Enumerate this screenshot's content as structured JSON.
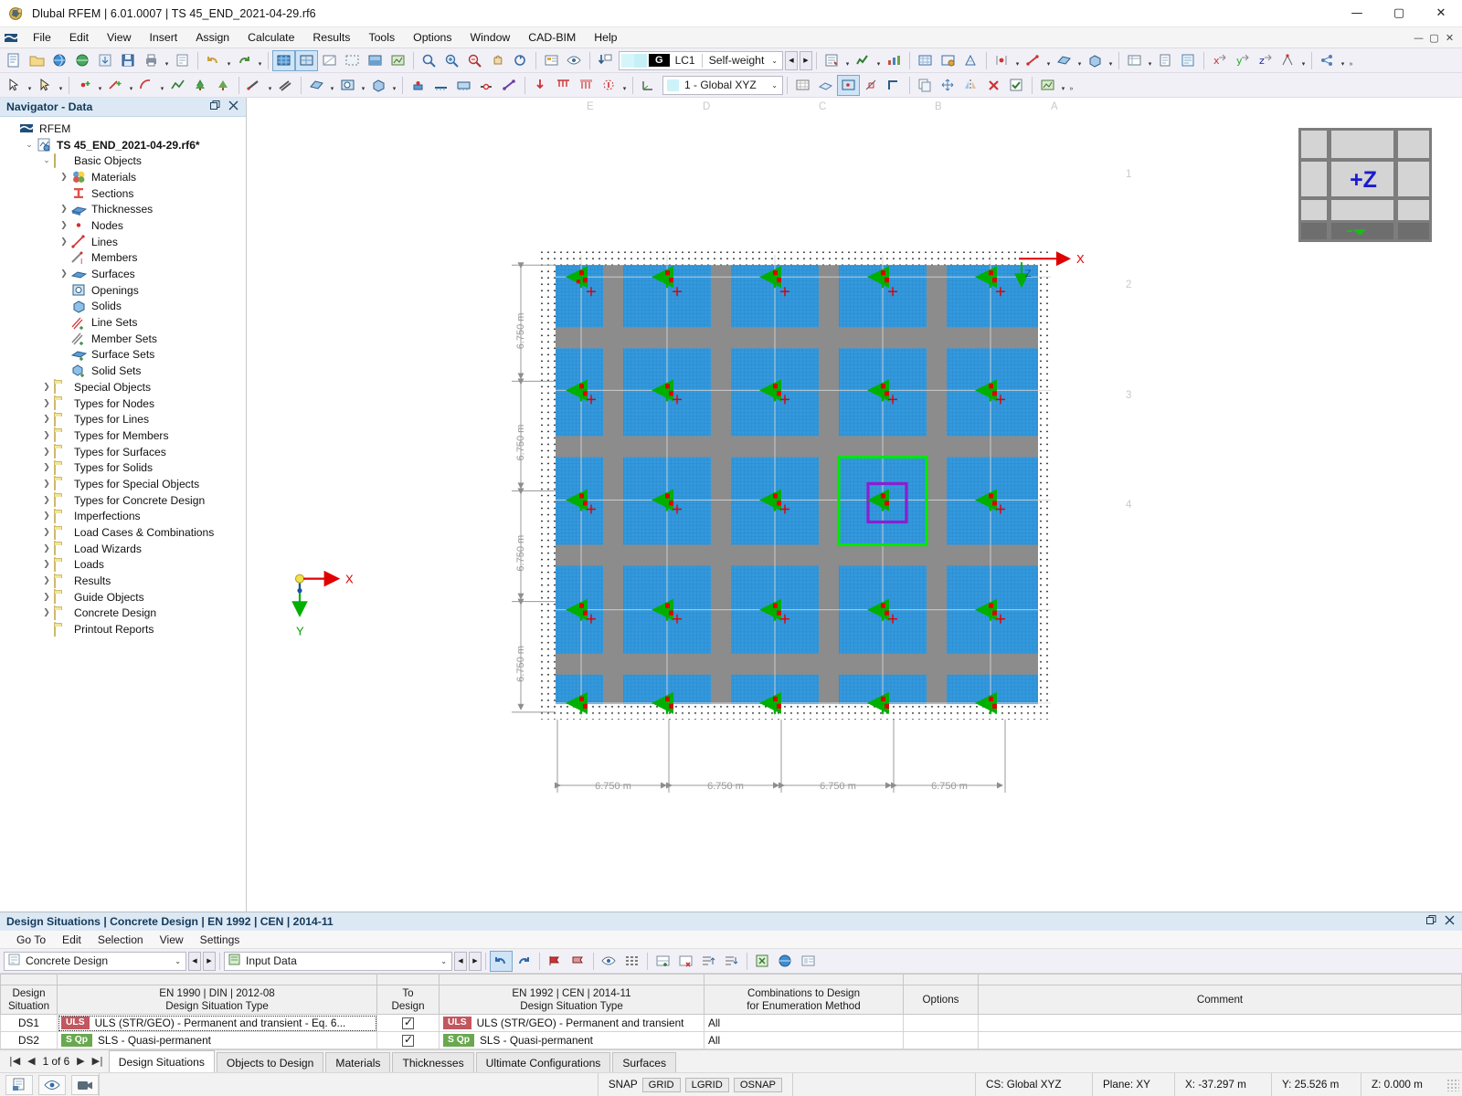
{
  "window": {
    "title": "Dlubal RFEM | 6.01.0007 | TS 45_END_2021-04-29.rf6",
    "app_icon": "rfem-logo-icon",
    "minimize": "—",
    "maximize": "▢",
    "close": "✕"
  },
  "menubar": {
    "items": [
      "File",
      "Edit",
      "View",
      "Insert",
      "Assign",
      "Calculate",
      "Results",
      "Tools",
      "Options",
      "Window",
      "CAD-BIM",
      "Help"
    ],
    "doc_buttons": [
      "—",
      "▢",
      "✕"
    ]
  },
  "toolbar": {
    "load_case": {
      "badge": "G",
      "id": "LC1",
      "name": "Self-weight",
      "caret": "⌄"
    },
    "coordinate_system": {
      "label": "1 - Global XYZ",
      "caret": "⌄"
    }
  },
  "navigator": {
    "title": "Navigator - Data",
    "restore_icon": "restore-icon",
    "close_icon": "close-icon",
    "tree": [
      {
        "label": "RFEM",
        "indent": 0,
        "twisty": "",
        "icon": "rfem-icon",
        "bold": false
      },
      {
        "label": "TS 45_END_2021-04-29.rf6*",
        "indent": 1,
        "twisty": "v",
        "icon": "model-icon",
        "bold": true
      },
      {
        "label": "Basic Objects",
        "indent": 2,
        "twisty": "v",
        "icon": "folder-open-icon",
        "bold": false
      },
      {
        "label": "Materials",
        "indent": 3,
        "twisty": ">",
        "icon": "materials-icon",
        "bold": false
      },
      {
        "label": "Sections",
        "indent": 3,
        "twisty": "",
        "icon": "sections-icon",
        "bold": false
      },
      {
        "label": "Thicknesses",
        "indent": 3,
        "twisty": ">",
        "icon": "thicknesses-icon",
        "bold": false
      },
      {
        "label": "Nodes",
        "indent": 3,
        "twisty": ">",
        "icon": "nodes-icon",
        "bold": false
      },
      {
        "label": "Lines",
        "indent": 3,
        "twisty": ">",
        "icon": "lines-icon",
        "bold": false
      },
      {
        "label": "Members",
        "indent": 3,
        "twisty": "",
        "icon": "members-icon",
        "bold": false
      },
      {
        "label": "Surfaces",
        "indent": 3,
        "twisty": ">",
        "icon": "surfaces-icon",
        "bold": false
      },
      {
        "label": "Openings",
        "indent": 3,
        "twisty": "",
        "icon": "openings-icon",
        "bold": false
      },
      {
        "label": "Solids",
        "indent": 3,
        "twisty": "",
        "icon": "solids-icon",
        "bold": false
      },
      {
        "label": "Line Sets",
        "indent": 3,
        "twisty": "",
        "icon": "line-sets-icon",
        "bold": false
      },
      {
        "label": "Member Sets",
        "indent": 3,
        "twisty": "",
        "icon": "member-sets-icon",
        "bold": false
      },
      {
        "label": "Surface Sets",
        "indent": 3,
        "twisty": "",
        "icon": "surface-sets-icon",
        "bold": false
      },
      {
        "label": "Solid Sets",
        "indent": 3,
        "twisty": "",
        "icon": "solid-sets-icon",
        "bold": false
      },
      {
        "label": "Special Objects",
        "indent": 2,
        "twisty": ">",
        "icon": "folder-icon",
        "bold": false
      },
      {
        "label": "Types for Nodes",
        "indent": 2,
        "twisty": ">",
        "icon": "folder-icon",
        "bold": false
      },
      {
        "label": "Types for Lines",
        "indent": 2,
        "twisty": ">",
        "icon": "folder-icon",
        "bold": false
      },
      {
        "label": "Types for Members",
        "indent": 2,
        "twisty": ">",
        "icon": "folder-icon",
        "bold": false
      },
      {
        "label": "Types for Surfaces",
        "indent": 2,
        "twisty": ">",
        "icon": "folder-icon",
        "bold": false
      },
      {
        "label": "Types for Solids",
        "indent": 2,
        "twisty": ">",
        "icon": "folder-icon",
        "bold": false
      },
      {
        "label": "Types for Special Objects",
        "indent": 2,
        "twisty": ">",
        "icon": "folder-icon",
        "bold": false
      },
      {
        "label": "Types for Concrete Design",
        "indent": 2,
        "twisty": ">",
        "icon": "folder-icon",
        "bold": false
      },
      {
        "label": "Imperfections",
        "indent": 2,
        "twisty": ">",
        "icon": "folder-icon",
        "bold": false
      },
      {
        "label": "Load Cases & Combinations",
        "indent": 2,
        "twisty": ">",
        "icon": "folder-icon",
        "bold": false
      },
      {
        "label": "Load Wizards",
        "indent": 2,
        "twisty": ">",
        "icon": "folder-icon",
        "bold": false
      },
      {
        "label": "Loads",
        "indent": 2,
        "twisty": ">",
        "icon": "folder-icon",
        "bold": false
      },
      {
        "label": "Results",
        "indent": 2,
        "twisty": ">",
        "icon": "folder-icon",
        "bold": false
      },
      {
        "label": "Guide Objects",
        "indent": 2,
        "twisty": ">",
        "icon": "folder-icon",
        "bold": false
      },
      {
        "label": "Concrete Design",
        "indent": 2,
        "twisty": ">",
        "icon": "folder-icon",
        "bold": false
      },
      {
        "label": "Printout Reports",
        "indent": 2,
        "twisty": "",
        "icon": "folder-icon",
        "bold": false
      }
    ]
  },
  "viewport": {
    "navcube_label": "+Z",
    "grid_letters": [
      "E",
      "D",
      "C",
      "B",
      "A"
    ],
    "grid_numbers": [
      "1",
      "2",
      "3",
      "4"
    ],
    "axis_x_label": "X",
    "axis_y_label": "Y",
    "axis_z_label": "Z",
    "dimension_label": "6.750 m",
    "vertical_dimensions": [
      "6.750 m",
      "6.750 m",
      "6.750 m",
      "6.750 m"
    ],
    "horizontal_dimensions": [
      "6.750 m",
      "6.750 m",
      "6.750 m",
      "6.750 m"
    ],
    "colors": {
      "slab": "#3399dd",
      "mesh": "#1b5fa8",
      "strip": "#8c8c8c",
      "selection_outer": "#00e800",
      "selection_inner": "#8a1fd0",
      "support_green": "#00c000",
      "support_red": "#e00000",
      "axis_red": "#e00000",
      "dimension_gray": "#9a9a9a"
    }
  },
  "bottom_panel": {
    "title": "Design Situations | Concrete Design | EN 1992 | CEN | 2014-11",
    "restore_icon": "restore-icon",
    "close_icon": "close-icon",
    "menu": [
      "Go To",
      "Edit",
      "Selection",
      "View",
      "Settings"
    ],
    "module_combo": "Concrete Design",
    "view_combo": "Input Data",
    "table": {
      "columns": [
        "Design\nSituation",
        "EN 1990 | DIN | 2012-08\nDesign Situation Type",
        "To\nDesign",
        "EN 1992 | CEN | 2014-11\nDesign Situation Type",
        "Combinations to Design\nfor Enumeration Method",
        "Options",
        "Comment"
      ],
      "columns_line1": [
        "Design",
        "EN 1990 | DIN | 2012-08",
        "To",
        "EN 1992 | CEN | 2014-11",
        "Combinations to Design",
        "Options",
        "Comment"
      ],
      "columns_line2": [
        "Situation",
        "Design Situation Type",
        "Design",
        "Design Situation Type",
        "for Enumeration Method",
        "",
        ""
      ],
      "rows": [
        {
          "situation": "DS1",
          "badge_left": "ULS",
          "badge_left_type": "uls",
          "type_left": "ULS (STR/GEO) - Permanent and transient - Eq. 6...",
          "to_design": true,
          "badge_right": "ULS",
          "badge_right_type": "uls",
          "type_right": "ULS (STR/GEO) - Permanent and transient",
          "combinations": "All",
          "options": "",
          "comment": "",
          "selected": true
        },
        {
          "situation": "DS2",
          "badge_left": "S Qp",
          "badge_left_type": "sls",
          "type_left": "SLS - Quasi-permanent",
          "to_design": true,
          "badge_right": "S Qp",
          "badge_right_type": "sls",
          "type_right": "SLS - Quasi-permanent",
          "combinations": "All",
          "options": "",
          "comment": "",
          "selected": false
        }
      ]
    }
  },
  "tabstrip": {
    "pager": {
      "first": "|◀",
      "prev": "◀",
      "text": "1 of 6",
      "next": "▶",
      "last": "▶|"
    },
    "tabs": [
      {
        "label": "Design Situations",
        "active": true
      },
      {
        "label": "Objects to Design",
        "active": false
      },
      {
        "label": "Materials",
        "active": false
      },
      {
        "label": "Thicknesses",
        "active": false
      },
      {
        "label": "Ultimate Configurations",
        "active": false
      },
      {
        "label": "Surfaces",
        "active": false
      }
    ]
  },
  "statusbar": {
    "snap_label": "SNAP",
    "toggles": [
      "GRID",
      "LGRID",
      "OSNAP"
    ],
    "cs": "CS: Global XYZ",
    "plane": "Plane: XY",
    "x": "X: -37.297 m",
    "y": "Y: 25.526 m",
    "z": "Z: 0.000 m"
  }
}
